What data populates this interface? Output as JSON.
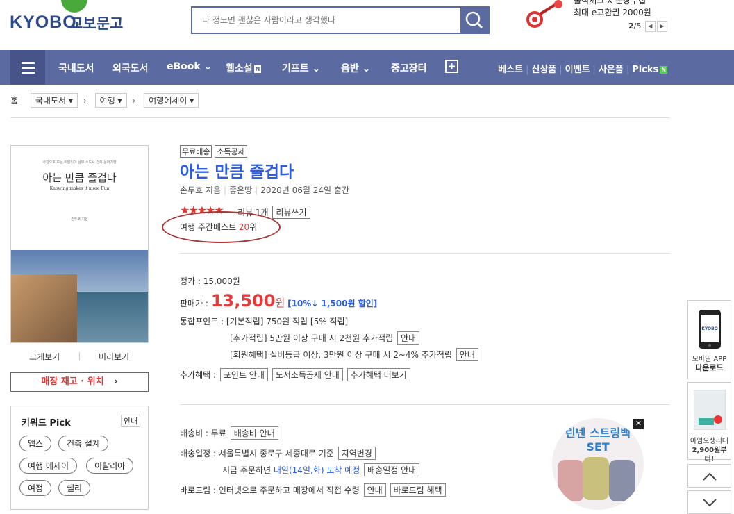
{
  "header": {
    "logo_text": "KYOBO",
    "logo_korean": "교보문고",
    "search_placeholder": "나 정도면 괜찮은 사람이라고 생각했다",
    "promo_line1": "출석체크 X 문장수집",
    "promo_line2": "최대 e교환권 2000원",
    "promo_page_current": "2",
    "promo_page_total": "/5"
  },
  "nav": {
    "items": [
      "국내도서",
      "외국도서",
      "eBook",
      "웹소설",
      "기프트",
      "음반",
      "중고장터"
    ],
    "right": [
      "베스트",
      "신상품",
      "이벤트",
      "사은품",
      "Picks"
    ],
    "new_badge": "N"
  },
  "breadcrumb": {
    "home": "홈",
    "crumbs": [
      "국내도서",
      "여행",
      "여행에세이"
    ]
  },
  "cover": {
    "subtitle_small": "사진으로 보는 이탈리아 남부 소도시 건축 문화기행",
    "title": "아는 만큼 즐겁다",
    "title_en": "Knowing makes it more Fun",
    "author_small": "손두호 지음",
    "photo_caption": "Photo Essay on Architecture and Cities of Southern Italy"
  },
  "cover_links": {
    "zoom": "크게보기",
    "preview": "미리보기"
  },
  "stock_button": "매장 재고 · 위치",
  "keywords": {
    "title": "키워드 Pick",
    "info_btn": "안내",
    "items": [
      "앱스",
      "건축 설계",
      "여행 에세이",
      "이탈리아",
      "여정",
      "쉘리"
    ]
  },
  "book": {
    "tags": [
      "무료배송",
      "소득공제"
    ],
    "title": "아는 만큼 즐겁다",
    "author": "손두호 지음",
    "publisher": "좋은땅",
    "date": "2020년 06월 24일 출간",
    "stars": "★★★★★",
    "rating": 5,
    "review_text": "리뷰 1개",
    "review_btn": "리뷰쓰기",
    "rank_prefix": "여행 주간베스트 ",
    "rank_num": "20",
    "rank_suffix": "위"
  },
  "price": {
    "list_label": "정가 :",
    "list_value": "15,000원",
    "sale_label": "판매가 :",
    "sale_value": "13,500",
    "sale_unit": "원",
    "discount": "[10%↓ 1,500원 할인]",
    "points_label": "통합포인트 :",
    "points_basic": "[기본적립] 750원 적립 [5% 적립]",
    "points_extra": "[추가적립] 5만원 이상 구매 시 2천원 추가적립",
    "points_member": "[회원혜택] 실버등급 이상, 3만원 이상 구매 시 2~4% 추가적립",
    "guide_btn": "안내",
    "benefit_label": "추가혜택 :",
    "benefit_btns": [
      "포인트 안내",
      "도서소득공제 안내",
      "추가혜택 더보기"
    ]
  },
  "delivery": {
    "fee_label": "배송비 : 무료",
    "fee_btn": "배송비 안내",
    "schedule_label": "배송일정 : 서울특별시 종로구 세종대로 기준",
    "region_btn": "지역변경",
    "order_now": "지금 주문하면",
    "arrival": "내일(14일,화) 도착 예정",
    "schedule_btn": "배송일정 안내",
    "baro_label": "바로드림 : 인터넷으로 주문하고 매장에서 직접 수령",
    "baro_btn1": "안내",
    "baro_btn2": "바로드림 혜택"
  },
  "ad": {
    "line1": "린넨 스트링백",
    "line2": "SET",
    "close": "✕"
  },
  "side": {
    "app_line1": "모바일 APP",
    "app_line2": "다운로드",
    "promo_line1": "아임오생리대",
    "promo_line2": "2,900원부터!",
    "up": "∧",
    "down": "∨"
  }
}
